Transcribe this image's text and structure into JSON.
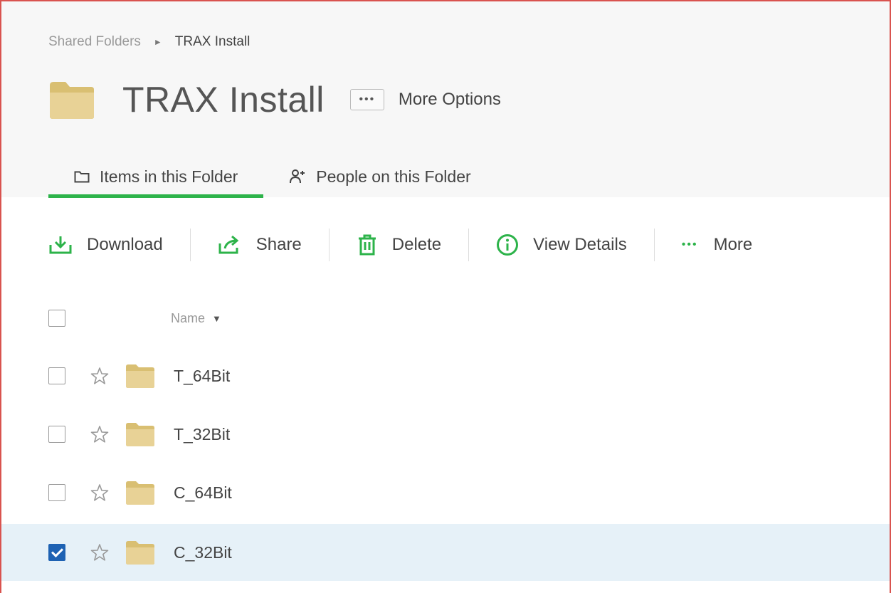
{
  "breadcrumb": {
    "root": "Shared Folders",
    "separator": "►",
    "current": "TRAX Install"
  },
  "header": {
    "title": "TRAX Install",
    "more_options_dots": "•••",
    "more_options_label": "More Options"
  },
  "tabs": [
    {
      "label": "Items in this Folder",
      "icon": "folder-outline-icon",
      "active": true
    },
    {
      "label": "People on this Folder",
      "icon": "person-add-icon",
      "active": false
    }
  ],
  "toolbar": {
    "download": "Download",
    "share": "Share",
    "delete": "Delete",
    "view_details": "View Details",
    "more_dots": "•••",
    "more": "More"
  },
  "list": {
    "column_name": "Name",
    "sort_indicator": "▼",
    "items": [
      {
        "name": "T_64Bit",
        "checked": false
      },
      {
        "name": "T_32Bit",
        "checked": false
      },
      {
        "name": "C_64Bit",
        "checked": false
      },
      {
        "name": "C_32Bit",
        "checked": true
      }
    ]
  },
  "colors": {
    "accent_green": "#2db34a",
    "folder": "#e6cf8a",
    "selected_row": "#e6f1f8",
    "checkbox_checked": "#1e62b3"
  }
}
